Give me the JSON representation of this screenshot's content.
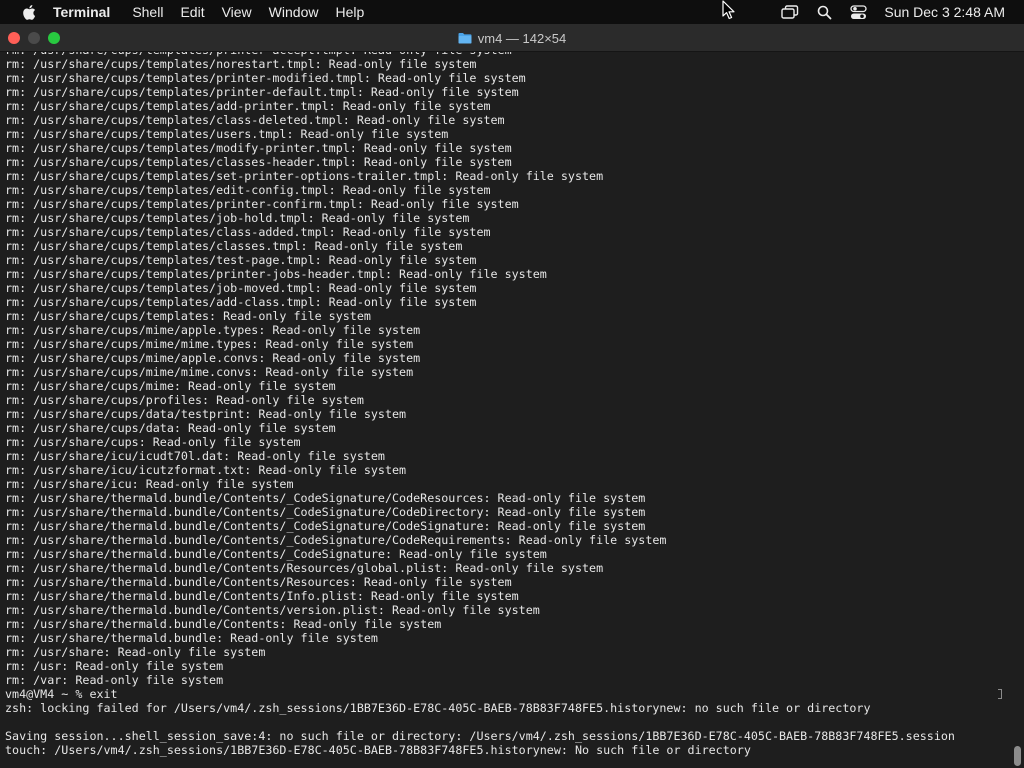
{
  "menubar": {
    "apple_icon": "apple-logo-icon",
    "app_name": "Terminal",
    "items": [
      "Shell",
      "Edit",
      "View",
      "Window",
      "Help"
    ],
    "status_icons": [
      "screen-mirroring-icon",
      "spotlight-search-icon",
      "control-center-icon"
    ],
    "clock": "Sun Dec 3  2:48 AM"
  },
  "window": {
    "title": "vm4 — 142×54",
    "folder_icon": "folder-icon",
    "traffic_light_colors": {
      "close": "#ff5f57",
      "minimize": "#4a4a4a",
      "zoom": "#28c840"
    }
  },
  "terminal": {
    "lines": [
      "rm: /usr/share/cups/templates/printer-accept.tmpl: Read-only file system",
      "rm: /usr/share/cups/templates/norestart.tmpl: Read-only file system",
      "rm: /usr/share/cups/templates/printer-modified.tmpl: Read-only file system",
      "rm: /usr/share/cups/templates/printer-default.tmpl: Read-only file system",
      "rm: /usr/share/cups/templates/add-printer.tmpl: Read-only file system",
      "rm: /usr/share/cups/templates/class-deleted.tmpl: Read-only file system",
      "rm: /usr/share/cups/templates/users.tmpl: Read-only file system",
      "rm: /usr/share/cups/templates/modify-printer.tmpl: Read-only file system",
      "rm: /usr/share/cups/templates/classes-header.tmpl: Read-only file system",
      "rm: /usr/share/cups/templates/set-printer-options-trailer.tmpl: Read-only file system",
      "rm: /usr/share/cups/templates/edit-config.tmpl: Read-only file system",
      "rm: /usr/share/cups/templates/printer-confirm.tmpl: Read-only file system",
      "rm: /usr/share/cups/templates/job-hold.tmpl: Read-only file system",
      "rm: /usr/share/cups/templates/class-added.tmpl: Read-only file system",
      "rm: /usr/share/cups/templates/classes.tmpl: Read-only file system",
      "rm: /usr/share/cups/templates/test-page.tmpl: Read-only file system",
      "rm: /usr/share/cups/templates/printer-jobs-header.tmpl: Read-only file system",
      "rm: /usr/share/cups/templates/job-moved.tmpl: Read-only file system",
      "rm: /usr/share/cups/templates/add-class.tmpl: Read-only file system",
      "rm: /usr/share/cups/templates: Read-only file system",
      "rm: /usr/share/cups/mime/apple.types: Read-only file system",
      "rm: /usr/share/cups/mime/mime.types: Read-only file system",
      "rm: /usr/share/cups/mime/apple.convs: Read-only file system",
      "rm: /usr/share/cups/mime/mime.convs: Read-only file system",
      "rm: /usr/share/cups/mime: Read-only file system",
      "rm: /usr/share/cups/profiles: Read-only file system",
      "rm: /usr/share/cups/data/testprint: Read-only file system",
      "rm: /usr/share/cups/data: Read-only file system",
      "rm: /usr/share/cups: Read-only file system",
      "rm: /usr/share/icu/icudt70l.dat: Read-only file system",
      "rm: /usr/share/icu/icutzformat.txt: Read-only file system",
      "rm: /usr/share/icu: Read-only file system",
      "rm: /usr/share/thermald.bundle/Contents/_CodeSignature/CodeResources: Read-only file system",
      "rm: /usr/share/thermald.bundle/Contents/_CodeSignature/CodeDirectory: Read-only file system",
      "rm: /usr/share/thermald.bundle/Contents/_CodeSignature/CodeSignature: Read-only file system",
      "rm: /usr/share/thermald.bundle/Contents/_CodeSignature/CodeRequirements: Read-only file system",
      "rm: /usr/share/thermald.bundle/Contents/_CodeSignature: Read-only file system",
      "rm: /usr/share/thermald.bundle/Contents/Resources/global.plist: Read-only file system",
      "rm: /usr/share/thermald.bundle/Contents/Resources: Read-only file system",
      "rm: /usr/share/thermald.bundle/Contents/Info.plist: Read-only file system",
      "rm: /usr/share/thermald.bundle/Contents/version.plist: Read-only file system",
      "rm: /usr/share/thermald.bundle/Contents: Read-only file system",
      "rm: /usr/share/thermald.bundle: Read-only file system",
      "rm: /usr/share: Read-only file system",
      "rm: /usr: Read-only file system",
      "rm: /var: Read-only file system",
      "vm4@VM4 ~ % exit",
      "zsh: locking failed for /Users/vm4/.zsh_sessions/1BB7E36D-E78C-405C-BAEB-78B83F748FE5.historynew: no such file or directory",
      "",
      "Saving session...shell_session_save:4: no such file or directory: /Users/vm4/.zsh_sessions/1BB7E36D-E78C-405C-BAEB-78B83F748FE5.session",
      "touch: /Users/vm4/.zsh_sessions/1BB7E36D-E78C-405C-BAEB-78B83F748FE5.historynew: No such file or directory"
    ]
  }
}
